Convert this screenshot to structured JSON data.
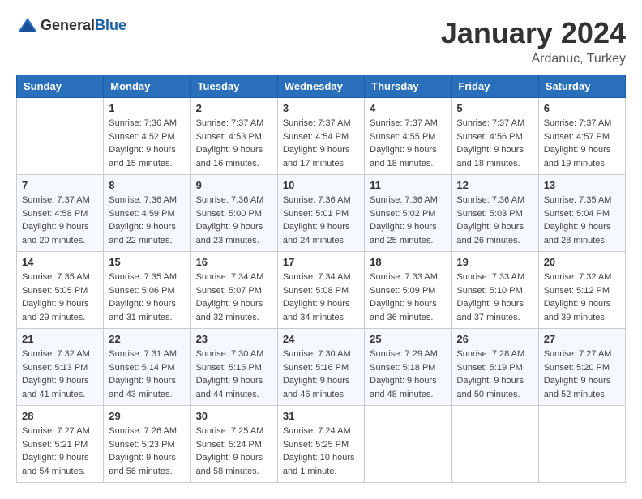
{
  "header": {
    "logo_general": "General",
    "logo_blue": "Blue",
    "month": "January 2024",
    "location": "Ardanuc, Turkey"
  },
  "weekdays": [
    "Sunday",
    "Monday",
    "Tuesday",
    "Wednesday",
    "Thursday",
    "Friday",
    "Saturday"
  ],
  "weeks": [
    [
      {
        "day": "",
        "info": ""
      },
      {
        "day": "1",
        "info": "Sunrise: 7:36 AM\nSunset: 4:52 PM\nDaylight: 9 hours\nand 15 minutes."
      },
      {
        "day": "2",
        "info": "Sunrise: 7:37 AM\nSunset: 4:53 PM\nDaylight: 9 hours\nand 16 minutes."
      },
      {
        "day": "3",
        "info": "Sunrise: 7:37 AM\nSunset: 4:54 PM\nDaylight: 9 hours\nand 17 minutes."
      },
      {
        "day": "4",
        "info": "Sunrise: 7:37 AM\nSunset: 4:55 PM\nDaylight: 9 hours\nand 18 minutes."
      },
      {
        "day": "5",
        "info": "Sunrise: 7:37 AM\nSunset: 4:56 PM\nDaylight: 9 hours\nand 18 minutes."
      },
      {
        "day": "6",
        "info": "Sunrise: 7:37 AM\nSunset: 4:57 PM\nDaylight: 9 hours\nand 19 minutes."
      }
    ],
    [
      {
        "day": "7",
        "info": "Sunrise: 7:37 AM\nSunset: 4:58 PM\nDaylight: 9 hours\nand 20 minutes."
      },
      {
        "day": "8",
        "info": "Sunrise: 7:36 AM\nSunset: 4:59 PM\nDaylight: 9 hours\nand 22 minutes."
      },
      {
        "day": "9",
        "info": "Sunrise: 7:36 AM\nSunset: 5:00 PM\nDaylight: 9 hours\nand 23 minutes."
      },
      {
        "day": "10",
        "info": "Sunrise: 7:36 AM\nSunset: 5:01 PM\nDaylight: 9 hours\nand 24 minutes."
      },
      {
        "day": "11",
        "info": "Sunrise: 7:36 AM\nSunset: 5:02 PM\nDaylight: 9 hours\nand 25 minutes."
      },
      {
        "day": "12",
        "info": "Sunrise: 7:36 AM\nSunset: 5:03 PM\nDaylight: 9 hours\nand 26 minutes."
      },
      {
        "day": "13",
        "info": "Sunrise: 7:35 AM\nSunset: 5:04 PM\nDaylight: 9 hours\nand 28 minutes."
      }
    ],
    [
      {
        "day": "14",
        "info": "Sunrise: 7:35 AM\nSunset: 5:05 PM\nDaylight: 9 hours\nand 29 minutes."
      },
      {
        "day": "15",
        "info": "Sunrise: 7:35 AM\nSunset: 5:06 PM\nDaylight: 9 hours\nand 31 minutes."
      },
      {
        "day": "16",
        "info": "Sunrise: 7:34 AM\nSunset: 5:07 PM\nDaylight: 9 hours\nand 32 minutes."
      },
      {
        "day": "17",
        "info": "Sunrise: 7:34 AM\nSunset: 5:08 PM\nDaylight: 9 hours\nand 34 minutes."
      },
      {
        "day": "18",
        "info": "Sunrise: 7:33 AM\nSunset: 5:09 PM\nDaylight: 9 hours\nand 36 minutes."
      },
      {
        "day": "19",
        "info": "Sunrise: 7:33 AM\nSunset: 5:10 PM\nDaylight: 9 hours\nand 37 minutes."
      },
      {
        "day": "20",
        "info": "Sunrise: 7:32 AM\nSunset: 5:12 PM\nDaylight: 9 hours\nand 39 minutes."
      }
    ],
    [
      {
        "day": "21",
        "info": "Sunrise: 7:32 AM\nSunset: 5:13 PM\nDaylight: 9 hours\nand 41 minutes."
      },
      {
        "day": "22",
        "info": "Sunrise: 7:31 AM\nSunset: 5:14 PM\nDaylight: 9 hours\nand 43 minutes."
      },
      {
        "day": "23",
        "info": "Sunrise: 7:30 AM\nSunset: 5:15 PM\nDaylight: 9 hours\nand 44 minutes."
      },
      {
        "day": "24",
        "info": "Sunrise: 7:30 AM\nSunset: 5:16 PM\nDaylight: 9 hours\nand 46 minutes."
      },
      {
        "day": "25",
        "info": "Sunrise: 7:29 AM\nSunset: 5:18 PM\nDaylight: 9 hours\nand 48 minutes."
      },
      {
        "day": "26",
        "info": "Sunrise: 7:28 AM\nSunset: 5:19 PM\nDaylight: 9 hours\nand 50 minutes."
      },
      {
        "day": "27",
        "info": "Sunrise: 7:27 AM\nSunset: 5:20 PM\nDaylight: 9 hours\nand 52 minutes."
      }
    ],
    [
      {
        "day": "28",
        "info": "Sunrise: 7:27 AM\nSunset: 5:21 PM\nDaylight: 9 hours\nand 54 minutes."
      },
      {
        "day": "29",
        "info": "Sunrise: 7:26 AM\nSunset: 5:23 PM\nDaylight: 9 hours\nand 56 minutes."
      },
      {
        "day": "30",
        "info": "Sunrise: 7:25 AM\nSunset: 5:24 PM\nDaylight: 9 hours\nand 58 minutes."
      },
      {
        "day": "31",
        "info": "Sunrise: 7:24 AM\nSunset: 5:25 PM\nDaylight: 10 hours\nand 1 minute."
      },
      {
        "day": "",
        "info": ""
      },
      {
        "day": "",
        "info": ""
      },
      {
        "day": "",
        "info": ""
      }
    ]
  ]
}
